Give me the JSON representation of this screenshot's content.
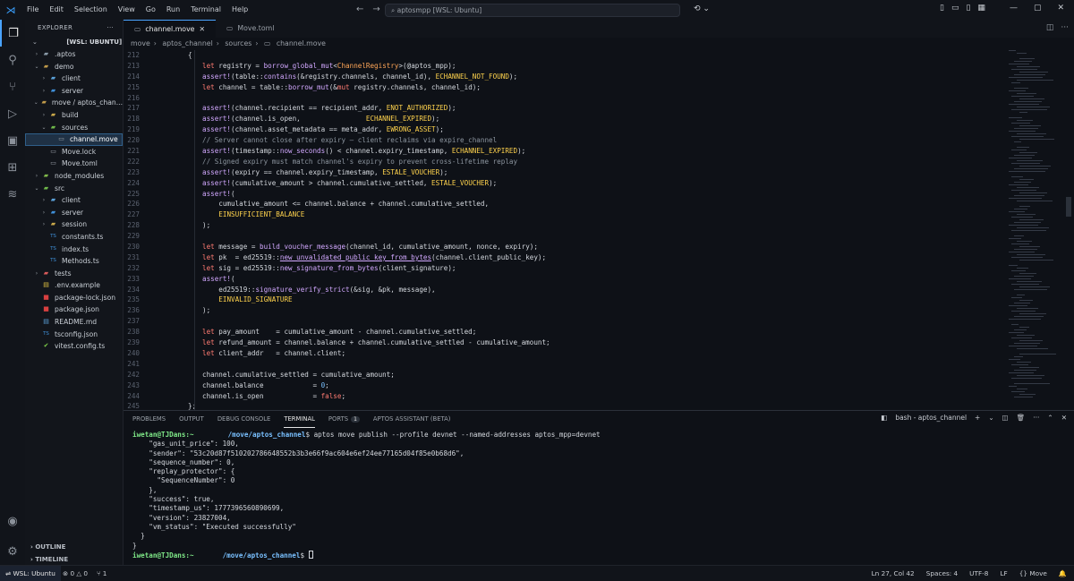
{
  "menu": [
    "File",
    "Edit",
    "Selection",
    "View",
    "Go",
    "Run",
    "Terminal",
    "Help"
  ],
  "search_text": "aptosmpp [WSL: Ubuntu]",
  "explorer": {
    "title": "EXPLORER",
    "root": "[WSL: UBUNTU]",
    "items": [
      {
        "label": ".aptos",
        "depth": 1,
        "chev": "›",
        "icon": "folder-icon",
        "glyph": "▰",
        "color": "#8a9aa8"
      },
      {
        "label": "demo",
        "depth": 1,
        "chev": "⌄",
        "icon": "folder-icon",
        "glyph": "▰",
        "color": "#c09a4a"
      },
      {
        "label": "client",
        "depth": 2,
        "chev": "›",
        "icon": "folder-icon",
        "glyph": "▰",
        "color": "#5aa0d8"
      },
      {
        "label": "server",
        "depth": 2,
        "chev": "›",
        "icon": "folder-icon",
        "glyph": "▰",
        "color": "#3f8fd8"
      },
      {
        "label": "move / aptos_chan...",
        "depth": 1,
        "chev": "⌄",
        "icon": "folder-icon",
        "glyph": "▰",
        "color": "#c09a4a"
      },
      {
        "label": "build",
        "depth": 2,
        "chev": "›",
        "icon": "folder-icon",
        "glyph": "▰",
        "color": "#c9a84a"
      },
      {
        "label": "sources",
        "depth": 2,
        "chev": "⌄",
        "icon": "folder-icon",
        "glyph": "▰",
        "color": "#6fb84a"
      },
      {
        "label": "channel.move",
        "depth": 3,
        "chev": "",
        "icon": "file-icon",
        "glyph": "▭",
        "color": "#9aa0a8",
        "selected": true
      },
      {
        "label": "Move.lock",
        "depth": 2,
        "chev": "",
        "icon": "file-icon",
        "glyph": "▭",
        "color": "#9aa0a8"
      },
      {
        "label": "Move.toml",
        "depth": 2,
        "chev": "",
        "icon": "file-icon",
        "glyph": "▭",
        "color": "#9aa0a8"
      },
      {
        "label": "node_modules",
        "depth": 1,
        "chev": "›",
        "icon": "folder-icon",
        "glyph": "▰",
        "color": "#7fb84a"
      },
      {
        "label": "src",
        "depth": 1,
        "chev": "⌄",
        "icon": "folder-icon",
        "glyph": "▰",
        "color": "#6fb84a"
      },
      {
        "label": "client",
        "depth": 2,
        "chev": "›",
        "icon": "folder-icon",
        "glyph": "▰",
        "color": "#5aa0d8"
      },
      {
        "label": "server",
        "depth": 2,
        "chev": "›",
        "icon": "folder-icon",
        "glyph": "▰",
        "color": "#3f8fd8"
      },
      {
        "label": "session",
        "depth": 2,
        "chev": "›",
        "icon": "folder-icon",
        "glyph": "▰",
        "color": "#c9a84a"
      },
      {
        "label": "constants.ts",
        "depth": 2,
        "chev": "",
        "icon": "ts-file-icon",
        "glyph": "TS",
        "color": "#3f8fd8"
      },
      {
        "label": "index.ts",
        "depth": 2,
        "chev": "",
        "icon": "ts-file-icon",
        "glyph": "TS",
        "color": "#3f8fd8"
      },
      {
        "label": "Methods.ts",
        "depth": 2,
        "chev": "",
        "icon": "ts-file-icon",
        "glyph": "TS",
        "color": "#3f8fd8"
      },
      {
        "label": "tests",
        "depth": 1,
        "chev": "›",
        "icon": "folder-icon",
        "glyph": "▰",
        "color": "#d85a5a"
      },
      {
        "label": ".env.example",
        "depth": 1,
        "chev": "",
        "icon": "env-file-icon",
        "glyph": "▤",
        "color": "#e0c040"
      },
      {
        "label": "package-lock.json",
        "depth": 1,
        "chev": "",
        "icon": "npm-file-icon",
        "glyph": "■",
        "color": "#d84040"
      },
      {
        "label": "package.json",
        "depth": 1,
        "chev": "",
        "icon": "npm-file-icon",
        "glyph": "■",
        "color": "#d84040"
      },
      {
        "label": "README.md",
        "depth": 1,
        "chev": "",
        "icon": "markdown-file-icon",
        "glyph": "▤",
        "color": "#5aa0d8"
      },
      {
        "label": "tsconfig.json",
        "depth": 1,
        "chev": "",
        "icon": "ts-file-icon",
        "glyph": "TS",
        "color": "#3f8fd8"
      },
      {
        "label": "vitest.config.ts",
        "depth": 1,
        "chev": "",
        "icon": "vitest-file-icon",
        "glyph": "✔",
        "color": "#7fd04a"
      }
    ],
    "outline": "OUTLINE",
    "timeline": "TIMELINE"
  },
  "tabs": [
    {
      "label": "channel.move",
      "active": true
    },
    {
      "label": "Move.toml",
      "active": false
    }
  ],
  "breadcrumb": [
    "move",
    "aptos_channel",
    "sources",
    "channel.move"
  ],
  "panel": {
    "tabs": [
      "PROBLEMS",
      "OUTPUT",
      "DEBUG CONSOLE",
      "TERMINAL",
      "PORTS",
      "APTOS ASSISTANT (BETA)"
    ],
    "ports_badge": "1",
    "active_tab": "TERMINAL",
    "terminal_name": "bash - aptos_channel"
  },
  "terminal": {
    "prompt1_user": "iwetan@TJDans:~",
    "prompt1_path": "/move/aptos_channel",
    "command": "$ aptos move publish --profile devnet --named-addresses aptos_mpp=devnet",
    "output": [
      "    \"gas_unit_price\": 100,",
      "    \"sender\": \"53c20d87f510202786648552b3b3e66f9ac604e6ef24ee77165d04f85e0b68d6\",",
      "    \"sequence_number\": 0,",
      "    \"replay_protector\": {",
      "      \"SequenceNumber\": 0",
      "    },",
      "    \"success\": true,",
      "    \"timestamp_us\": 1777396560890699,",
      "    \"version\": 23827004,",
      "    \"vm_status\": \"Executed successfully\"",
      "  }",
      "}"
    ],
    "prompt2_user": "iwetan@TJDans:~",
    "prompt2_path": "/move/aptos_channel",
    "prompt2_end": "$ "
  },
  "status": {
    "remote": "WSL: Ubuntu",
    "errors": "0",
    "warnings": "0",
    "ports": "1",
    "position": "Ln 27, Col 42",
    "spaces": "Spaces: 4",
    "encoding": "UTF-8",
    "eol": "LF",
    "language": "Move"
  },
  "code_lines": [
    {
      "n": "212",
      "h": "<span style=\"margin-left:-16px\">{</span>"
    },
    {
      "n": "213",
      "h": "<span class=\"k\">let</span> registry = <span class=\"f\">borrow_global_mut</span>&lt;<span class=\"m\">ChannelRegistry</span>&gt;(@aptos_mpp);"
    },
    {
      "n": "214",
      "h": "<span class=\"f\">assert!</span>(table::<span class=\"f\">contains</span>(&amp;registry.channels, channel_id), <span class=\"e\">ECHANNEL_NOT_FOUND</span>);"
    },
    {
      "n": "215",
      "h": "<span class=\"k\">let</span> channel = table::<span class=\"f\">borrow_mut</span>(&amp;<span class=\"k\">mut</span> registry.channels, channel_id);"
    },
    {
      "n": "216",
      "h": ""
    },
    {
      "n": "217",
      "h": "<span class=\"f\">assert!</span>(channel.recipient == recipient_addr, <span class=\"e\">ENOT_AUTHORIZED</span>);"
    },
    {
      "n": "218",
      "h": "<span class=\"f\">assert!</span>(channel.is_open,                <span class=\"e\">ECHANNEL_EXPIRED</span>);"
    },
    {
      "n": "219",
      "h": "<span class=\"f\">assert!</span>(channel.asset_metadata == meta_addr, <span class=\"e\">EWRONG_ASSET</span>);"
    },
    {
      "n": "220",
      "h": "<span class=\"c\">// Server cannot close after expiry — client reclaims via expire_channel</span>"
    },
    {
      "n": "221",
      "h": "<span class=\"f\">assert!</span>(timestamp::<span class=\"f\">now_seconds</span>() &lt; channel.expiry_timestamp, <span class=\"e\">ECHANNEL_EXPIRED</span>);"
    },
    {
      "n": "222",
      "h": "<span class=\"c\">// Signed expiry must match channel's expiry to prevent cross-lifetime replay</span>"
    },
    {
      "n": "223",
      "h": "<span class=\"f\">assert!</span>(expiry == channel.expiry_timestamp, <span class=\"e\">ESTALE_VOUCHER</span>);"
    },
    {
      "n": "224",
      "h": "<span class=\"f\">assert!</span>(cumulative_amount &gt; channel.cumulative_settled, <span class=\"e\">ESTALE_VOUCHER</span>);"
    },
    {
      "n": "225",
      "h": "<span class=\"f\">assert!</span>("
    },
    {
      "n": "226",
      "h": "    cumulative_amount &lt;= channel.balance + channel.cumulative_settled,"
    },
    {
      "n": "227",
      "h": "    <span class=\"e\">EINSUFFICIENT_BALANCE</span>"
    },
    {
      "n": "228",
      "h": ");"
    },
    {
      "n": "229",
      "h": ""
    },
    {
      "n": "230",
      "h": "<span class=\"k\">let</span> message = <span class=\"f\">build_voucher_message</span>(channel_id, cumulative_amount, nonce, expiry);"
    },
    {
      "n": "231",
      "h": "<span class=\"k\">let</span> pk  = ed25519::<span class=\"f\"><u>new_unvalidated_public_key_from_bytes</u></span>(channel.client_public_key);"
    },
    {
      "n": "232",
      "h": "<span class=\"k\">let</span> sig = ed25519::<span class=\"f\">new_signature_from_bytes</span>(client_signature);"
    },
    {
      "n": "233",
      "h": "<span class=\"f\">assert!</span>("
    },
    {
      "n": "234",
      "h": "    ed25519::<span class=\"f\">signature_verify_strict</span>(&amp;sig, &amp;pk, message),"
    },
    {
      "n": "235",
      "h": "    <span class=\"e\">EINVALID_SIGNATURE</span>"
    },
    {
      "n": "236",
      "h": ");"
    },
    {
      "n": "237",
      "h": ""
    },
    {
      "n": "238",
      "h": "<span class=\"k\">let</span> pay_amount    = cumulative_amount - channel.cumulative_settled;"
    },
    {
      "n": "239",
      "h": "<span class=\"k\">let</span> refund_amount = channel.balance + channel.cumulative_settled - cumulative_amount;"
    },
    {
      "n": "240",
      "h": "<span class=\"k\">let</span> client_addr   = channel.client;"
    },
    {
      "n": "241",
      "h": ""
    },
    {
      "n": "242",
      "h": "channel.cumulative_settled = cumulative_amount;"
    },
    {
      "n": "243",
      "h": "channel.balance            = <span class=\"n\">0</span>;"
    },
    {
      "n": "244",
      "h": "channel.is_open            = <span class=\"k\">false</span>;"
    },
    {
      "n": "245",
      "h": "<span style=\"margin-left:-16px\">};</span>"
    }
  ]
}
